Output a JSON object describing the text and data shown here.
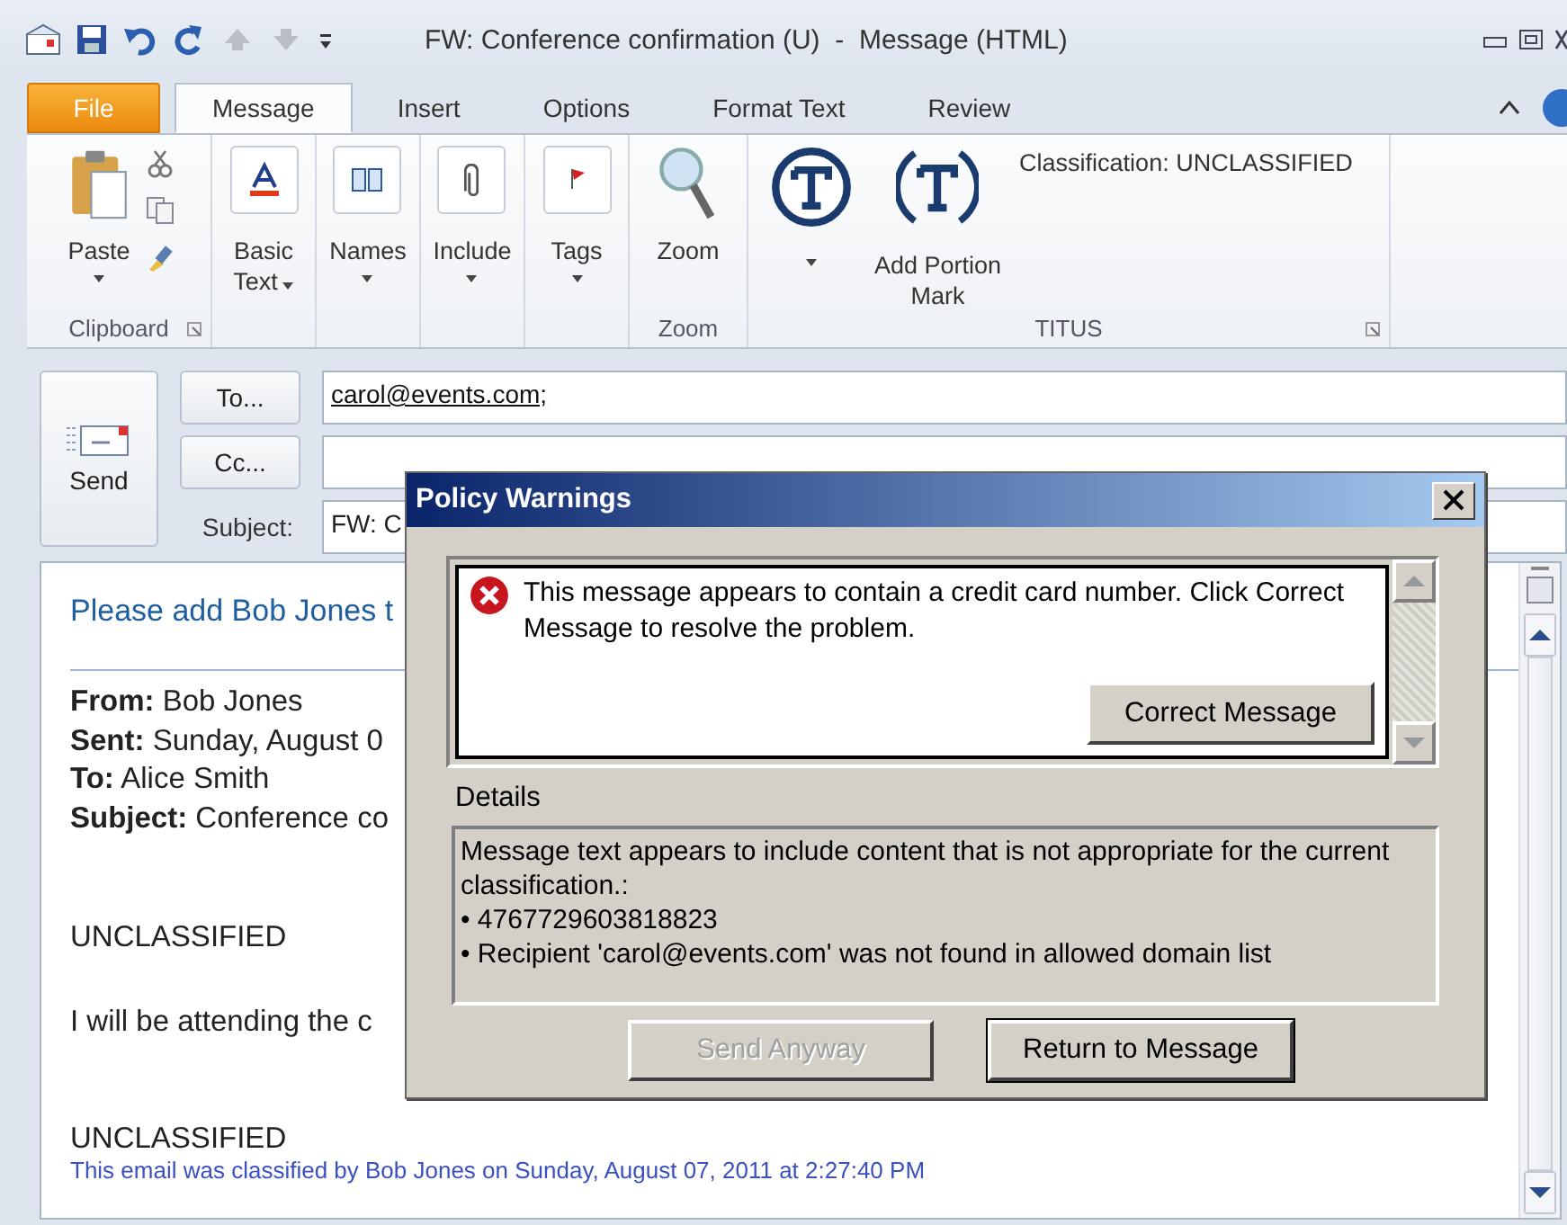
{
  "window": {
    "title": "FW: Conference confirmation (U)  -  Message (HTML)"
  },
  "tabs": [
    {
      "label": "File",
      "kind": "file",
      "selected": false
    },
    {
      "label": "Message",
      "kind": "tab",
      "selected": true
    },
    {
      "label": "Insert",
      "kind": "tab",
      "selected": false
    },
    {
      "label": "Options",
      "kind": "tab",
      "selected": false
    },
    {
      "label": "Format Text",
      "kind": "tab",
      "selected": false
    },
    {
      "label": "Review",
      "kind": "tab",
      "selected": false
    }
  ],
  "ribbon": {
    "paste": "Paste",
    "basic_text": [
      "Basic",
      "Text"
    ],
    "names": "Names",
    "include": "Include",
    "tags": "Tags",
    "zoom": "Zoom",
    "add_portion_mark": [
      "Add Portion",
      "Mark"
    ],
    "classification": "Classification:  UNCLASSIFIED",
    "groups": [
      "Clipboard",
      "Zoom",
      "TITUS"
    ]
  },
  "header": {
    "send": "Send",
    "to_button": "To...",
    "cc_button": "Cc...",
    "subject_label": "Subject:",
    "to_value": "carol@events.com;",
    "subject_value": "FW: C"
  },
  "body": {
    "intro": "Please add Bob Jones t",
    "fields": [
      {
        "label": "From:",
        "value": "Bob Jones"
      },
      {
        "label": "Sent:",
        "value": "Sunday, August 0"
      },
      {
        "label": "To:",
        "value": "Alice Smith"
      },
      {
        "label": "Subject:",
        "value": "Conference co"
      }
    ],
    "marking_top": "UNCLASSIFIED",
    "text": "I will be attending the c",
    "marking_bottom": "UNCLASSIFIED",
    "footer": "This email was classified by Bob Jones on Sunday, August 07, 2011 at 2:27:40 PM"
  },
  "dialog": {
    "title": "Policy Warnings",
    "warning": "This message appears to contain a credit card number. Click Correct Message to resolve the problem.",
    "correct_button": "Correct Message",
    "details_label": "Details",
    "details": [
      "Message text appears to include content that is not appropriate for the current classification.:",
      "• 4767729603818823",
      "• Recipient 'carol@events.com' was not found in allowed domain list"
    ],
    "buttons": [
      {
        "label": "Send Anyway",
        "disabled": true,
        "default": false
      },
      {
        "label": "Return to Message",
        "disabled": false,
        "default": true
      }
    ]
  }
}
